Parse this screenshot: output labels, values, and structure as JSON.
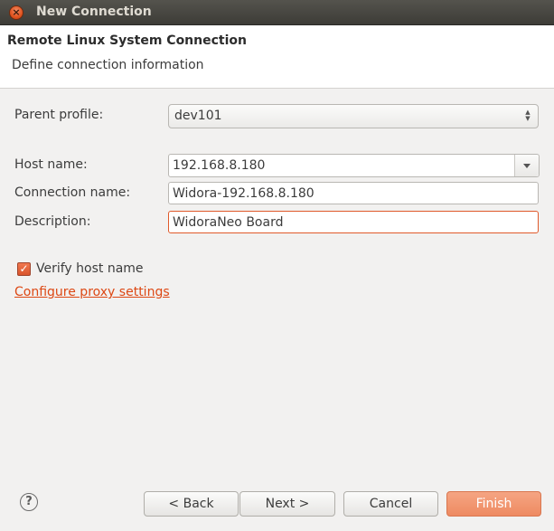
{
  "window": {
    "title": "New Connection",
    "close_glyph": "×"
  },
  "header": {
    "title": "Remote Linux System Connection",
    "description": "Define connection information"
  },
  "form": {
    "parent_profile": {
      "label": "Parent profile:",
      "value": "dev101"
    },
    "host_name": {
      "label": "Host name:",
      "value": "192.168.8.180"
    },
    "connection_name": {
      "label": "Connection name:",
      "value": "Widora-192.168.8.180"
    },
    "description": {
      "label": "Description:",
      "value": "WidoraNeo Board"
    },
    "verify_host": {
      "label": "Verify host name",
      "checked": true,
      "glyph": "✓"
    },
    "proxy_link": "Configure proxy settings"
  },
  "footer": {
    "help_glyph": "?",
    "back": "< Back",
    "next": "Next >",
    "cancel": "Cancel",
    "finish": "Finish"
  },
  "colors": {
    "accent": "#dd4814",
    "finish_button": "#ee8a61"
  }
}
